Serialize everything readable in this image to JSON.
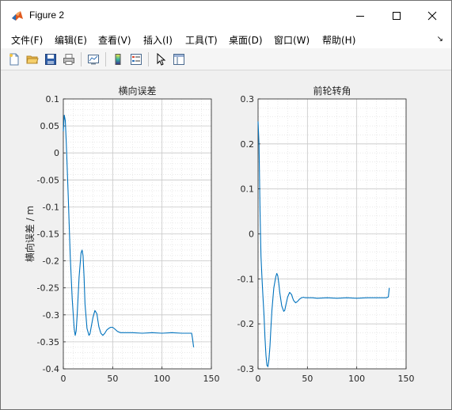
{
  "window": {
    "title": "Figure 2"
  },
  "menu": [
    "文件(F)",
    "编辑(E)",
    "查看(V)",
    "插入(I)",
    "工具(T)",
    "桌面(D)",
    "窗口(W)",
    "帮助(H)"
  ],
  "toolbar": [
    "new-figure-icon",
    "open-folder-icon",
    "save-icon",
    "print-icon",
    "link-plot-icon",
    "colorbar-icon",
    "legend-icon",
    "pointer-icon",
    "property-editor-icon"
  ],
  "colors": {
    "line": "#0072bd",
    "grid": "#dcdcdc",
    "axes_bg": "#ffffff",
    "figure_bg": "#f0f0f0"
  },
  "chart_data": [
    {
      "type": "line",
      "title": "横向误差",
      "xlabel": "",
      "ylabel": "横向误差 / m",
      "xlim": [
        0,
        150
      ],
      "ylim": [
        -0.4,
        0.1
      ],
      "xticks": [
        "0",
        "50",
        "100",
        "150"
      ],
      "yticks": [
        "0.1",
        "0.05",
        "0",
        "-0.05",
        "-0.1",
        "-0.15",
        "-0.2",
        "-0.25",
        "-0.3",
        "-0.35",
        "-0.4"
      ],
      "grid": true,
      "series": [
        {
          "x": [
            0,
            1,
            2,
            3,
            5,
            7,
            9,
            11,
            12,
            13,
            14,
            16,
            18,
            19,
            20,
            21,
            22,
            24,
            26,
            27,
            28,
            30,
            32,
            34,
            35,
            36,
            38,
            40,
            42,
            44,
            46,
            48,
            50,
            52,
            55,
            58,
            62,
            70,
            80,
            90,
            100,
            110,
            120,
            130,
            131,
            132
          ],
          "y": [
            0.04,
            0.07,
            0.06,
            0.02,
            -0.08,
            -0.19,
            -0.27,
            -0.325,
            -0.338,
            -0.33,
            -0.3,
            -0.23,
            -0.185,
            -0.18,
            -0.19,
            -0.23,
            -0.28,
            -0.325,
            -0.338,
            -0.335,
            -0.325,
            -0.305,
            -0.292,
            -0.298,
            -0.31,
            -0.322,
            -0.334,
            -0.338,
            -0.334,
            -0.328,
            -0.325,
            -0.323,
            -0.323,
            -0.326,
            -0.331,
            -0.333,
            -0.333,
            -0.333,
            -0.334,
            -0.333,
            -0.334,
            -0.333,
            -0.334,
            -0.334,
            -0.345,
            -0.36
          ]
        }
      ]
    },
    {
      "type": "line",
      "title": "前轮转角",
      "xlabel": "",
      "ylabel": "",
      "xlim": [
        0,
        150
      ],
      "ylim": [
        -0.3,
        0.3
      ],
      "xticks": [
        "0",
        "50",
        "100",
        "150"
      ],
      "yticks": [
        "0.3",
        "0.2",
        "0.1",
        "0",
        "-0.1",
        "-0.2",
        "-0.3"
      ],
      "grid": true,
      "series": [
        {
          "x": [
            0,
            1,
            2,
            3,
            4,
            5,
            6,
            7,
            8,
            9,
            10,
            11,
            12,
            13,
            14,
            16,
            18,
            19,
            20,
            21,
            22,
            24,
            26,
            27,
            28,
            30,
            32,
            34,
            35,
            36,
            38,
            40,
            42,
            44,
            46,
            48,
            50,
            55,
            60,
            70,
            80,
            90,
            100,
            110,
            120,
            130,
            132,
            133
          ],
          "y": [
            0.25,
            0.2,
            0.05,
            -0.05,
            -0.1,
            -0.14,
            -0.18,
            -0.23,
            -0.27,
            -0.292,
            -0.295,
            -0.28,
            -0.25,
            -0.21,
            -0.17,
            -0.12,
            -0.095,
            -0.088,
            -0.093,
            -0.11,
            -0.13,
            -0.16,
            -0.172,
            -0.17,
            -0.16,
            -0.14,
            -0.13,
            -0.135,
            -0.142,
            -0.148,
            -0.153,
            -0.15,
            -0.145,
            -0.142,
            -0.141,
            -0.142,
            -0.142,
            -0.142,
            -0.143,
            -0.142,
            -0.143,
            -0.142,
            -0.143,
            -0.142,
            -0.142,
            -0.142,
            -0.14,
            -0.12
          ]
        }
      ]
    }
  ]
}
